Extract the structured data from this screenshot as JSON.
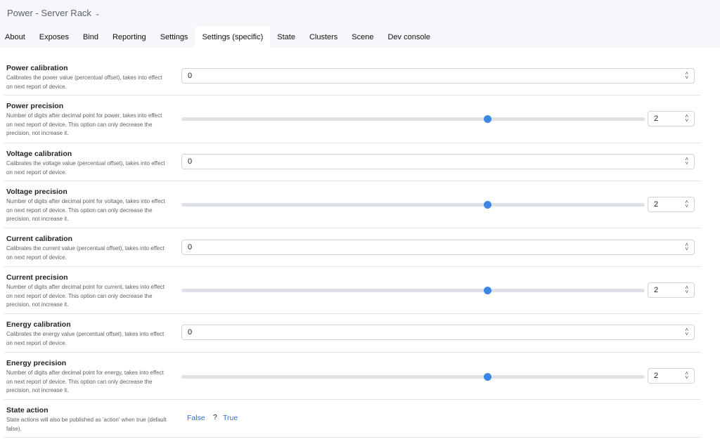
{
  "app": {
    "title": "Power - Server Rack"
  },
  "tabs": [
    {
      "label": "About"
    },
    {
      "label": "Exposes"
    },
    {
      "label": "Bind"
    },
    {
      "label": "Reporting"
    },
    {
      "label": "Settings"
    },
    {
      "label": "Settings (specific)",
      "active": true
    },
    {
      "label": "State"
    },
    {
      "label": "Clusters"
    },
    {
      "label": "Scene"
    },
    {
      "label": "Dev console"
    }
  ],
  "settings": {
    "power_calibration": {
      "label": "Power calibration",
      "description": "Calibrates the power value (percentual offset), takes into effect on next report of device.",
      "value": "0"
    },
    "power_precision": {
      "label": "Power precision",
      "description": "Number of digits after decimal point for power, takes into effect on next report of device. This option can only decrease the precision, not increase it.",
      "value": "2",
      "slider_fraction": 0.66
    },
    "voltage_calibration": {
      "label": "Voltage calibration",
      "description": "Calibrates the voltage value (percentual offset), takes into effect on next report of device.",
      "value": "0"
    },
    "voltage_precision": {
      "label": "Voltage precision",
      "description": "Number of digits after decimal point for voltage, takes into effect on next report of device. This option can only decrease the precision, not increase it.",
      "value": "2",
      "slider_fraction": 0.66
    },
    "current_calibration": {
      "label": "Current calibration",
      "description": "Calibrates the current value (percentual offset), takes into effect on next report of device.",
      "value": "0"
    },
    "current_precision": {
      "label": "Current precision",
      "description": "Number of digits after decimal point for current, takes into effect on next report of device. This option can only decrease the precision, not increase it.",
      "value": "2",
      "slider_fraction": 0.66
    },
    "energy_calibration": {
      "label": "Energy calibration",
      "description": "Calibrates the energy value (percentual offset), takes into effect on next report of device.",
      "value": "0"
    },
    "energy_precision": {
      "label": "Energy precision",
      "description": "Number of digits after decimal point for energy, takes into effect on next report of device. This option can only decrease the precision, not increase it.",
      "value": "2",
      "slider_fraction": 0.66
    },
    "state_action": {
      "label": "State action",
      "description": "State actions will also be published as 'action' when true (default false).",
      "option_false": "False",
      "separator": "?",
      "option_true": "True"
    }
  },
  "icons": {
    "title_dropdown": "chevron-down-icon",
    "spinner": "spinner-arrows-icon"
  },
  "colors": {
    "accent": "#3c86e4",
    "link": "#2e72d2",
    "page_bg": "#f6f7fb",
    "panel_bg": "#ffffff"
  }
}
